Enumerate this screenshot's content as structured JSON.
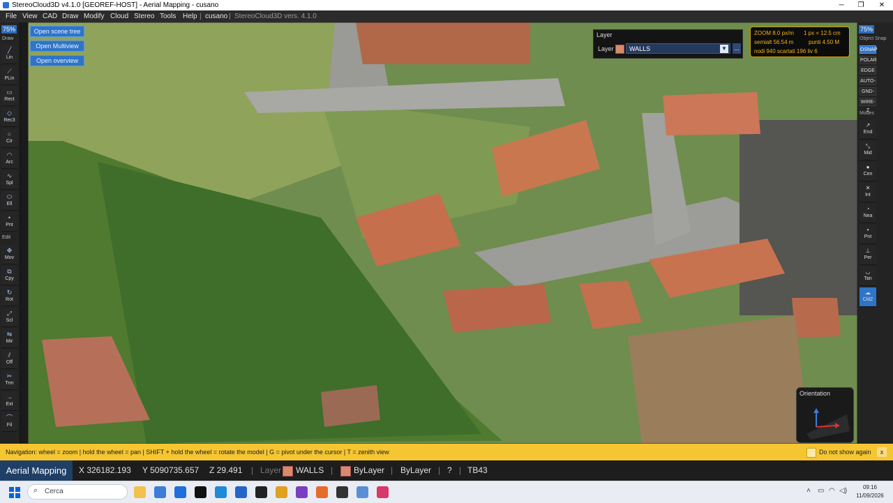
{
  "window": {
    "title": "StereoCloud3D v4.1.0  [GEOREF-HOST]  - Aerial Mapping  - cusano",
    "minimize": "─",
    "maximize": "❐",
    "close": "✕"
  },
  "menu": {
    "items": [
      "File",
      "View",
      "CAD",
      "Draw",
      "Modify",
      "Cloud",
      "Stereo",
      "Tools",
      "Help"
    ],
    "project": "cusano",
    "version": "StereoCloud3D vers. 4.1.0"
  },
  "left_toolbar": {
    "zoom": "75%",
    "draw_label": "Draw",
    "edit_label": "Edit",
    "draw_tools": [
      {
        "label": "Lin",
        "icon": "line-icon",
        "glyph": "╱"
      },
      {
        "label": "PLin",
        "icon": "polyline-icon",
        "glyph": "⟋"
      },
      {
        "label": "Rect",
        "icon": "rectangle-icon",
        "glyph": "▭"
      },
      {
        "label": "Rec3",
        "icon": "rectangle-3pt-icon",
        "glyph": "◇"
      },
      {
        "label": "Cir",
        "icon": "circle-icon",
        "glyph": "○"
      },
      {
        "label": "Arc",
        "icon": "arc-icon",
        "glyph": "◠"
      },
      {
        "label": "Spl",
        "icon": "spline-icon",
        "glyph": "∿"
      },
      {
        "label": "Ell",
        "icon": "ellipse-icon",
        "glyph": "⬭"
      },
      {
        "label": "Pnt",
        "icon": "point-icon",
        "glyph": "•"
      }
    ],
    "edit_tools": [
      {
        "label": "Mov",
        "icon": "move-icon",
        "glyph": "✥"
      },
      {
        "label": "Cpy",
        "icon": "copy-icon",
        "glyph": "⧉"
      },
      {
        "label": "Rot",
        "icon": "rotate-icon",
        "glyph": "↻"
      },
      {
        "label": "Scl",
        "icon": "scale-icon",
        "glyph": "⤢"
      },
      {
        "label": "Mir",
        "icon": "mirror-icon",
        "glyph": "⇋"
      },
      {
        "label": "Off",
        "icon": "offset-icon",
        "glyph": "⫽"
      },
      {
        "label": "Trm",
        "icon": "trim-icon",
        "glyph": "✂"
      },
      {
        "label": "Ext",
        "icon": "extend-icon",
        "glyph": "→"
      },
      {
        "label": "Fil",
        "icon": "fillet-icon",
        "glyph": "⌒"
      }
    ]
  },
  "overlay_buttons": [
    "Open scene tree",
    "Open Multiview",
    "Open overview"
  ],
  "layer_panel": {
    "title": "Layer",
    "label": "Layer",
    "value": "WALLS",
    "more": "...",
    "swatch_color": "#d98a6c"
  },
  "info_box": {
    "zoom": "ZOOM  8.0 px/m",
    "px": "1 px = 12.5 cm",
    "semialt": "semialt 56.54 m",
    "punti": "punti 4.50 M",
    "nodi": "nodi 940  scartati 196  liv 6"
  },
  "right_toolbar": {
    "zoom": "75%",
    "snap_label": "Object Snap",
    "snaps": [
      {
        "label": "OSNAP",
        "on": true
      },
      {
        "label": "POLAR",
        "on": false
      },
      {
        "label": "EDGE",
        "on": false
      },
      {
        "label": "AUTO-",
        "on": false
      },
      {
        "label": "GND-Z",
        "on": false
      },
      {
        "label": "WIRE-Z",
        "on": false
      }
    ],
    "modes_label": "Modes",
    "modes": [
      {
        "label": "End",
        "icon": "endpoint-icon",
        "glyph": "↗",
        "on": false
      },
      {
        "label": "Mid",
        "icon": "midpoint-icon",
        "glyph": "⤡",
        "on": false
      },
      {
        "label": "Cen",
        "icon": "center-icon",
        "glyph": "●",
        "on": false
      },
      {
        "label": "Int",
        "icon": "intersection-icon",
        "glyph": "✕",
        "on": false
      },
      {
        "label": "Nea",
        "icon": "nearest-icon",
        "glyph": "◔",
        "on": false
      },
      {
        "label": "Pnt",
        "icon": "node-icon",
        "glyph": "•",
        "on": false
      },
      {
        "label": "Per",
        "icon": "perpendicular-icon",
        "glyph": "⊥",
        "on": false
      },
      {
        "label": "Tan",
        "icon": "tangent-icon",
        "glyph": "◡",
        "on": false
      },
      {
        "label": "CldZ",
        "icon": "cloud-z-icon",
        "glyph": "☁",
        "on": true
      }
    ]
  },
  "orientation": {
    "title": "Orientation"
  },
  "nav_bar": {
    "text": "Navigation:  wheel = zoom   |  hold the wheel = pan   |  SHIFT + hold the wheel = rotate the model   |  G = pivot under the cursor   |  T = zenith view",
    "dont_show": "Do not show again",
    "close": "x"
  },
  "status": {
    "mode": "Aerial Mapping",
    "x": "X 326182.193",
    "y": "Y 5090735.657",
    "z": "Z 29.491",
    "layer_label": "Layer",
    "layer_value": "WALLS",
    "color": "ByLayer",
    "linetype": "ByLayer",
    "help": "?",
    "tb": "TB43",
    "sep": "|"
  },
  "taskbar": {
    "search_placeholder": "Cerca",
    "time": "09:16",
    "date": "11/09/2026",
    "apps": [
      {
        "name": "file-explorer-icon",
        "color": "#f2c14e"
      },
      {
        "name": "store-icon",
        "color": "#3b7dd8"
      },
      {
        "name": "sky-go-icon",
        "color": "#1f6fdc"
      },
      {
        "name": "capcut-icon",
        "color": "#111111"
      },
      {
        "name": "vscode-icon",
        "color": "#1f8ad8"
      },
      {
        "name": "app-blue-icon",
        "color": "#2565c8"
      },
      {
        "name": "chatgpt-icon",
        "color": "#222222"
      },
      {
        "name": "chrome-icon",
        "color": "#e0a020"
      },
      {
        "name": "visual-studio-icon",
        "color": "#7a3fc0"
      },
      {
        "name": "app-orange-icon",
        "color": "#e56b2c"
      },
      {
        "name": "terminal-icon",
        "color": "#333333"
      },
      {
        "name": "stereocloud-icon",
        "color": "#5a8fd6"
      },
      {
        "name": "snipping-icon",
        "color": "#d8386c"
      }
    ]
  },
  "colors": {
    "accent": "#2f74c8",
    "nav_bar": "#f5c532",
    "info_text": "#f2b51a"
  }
}
